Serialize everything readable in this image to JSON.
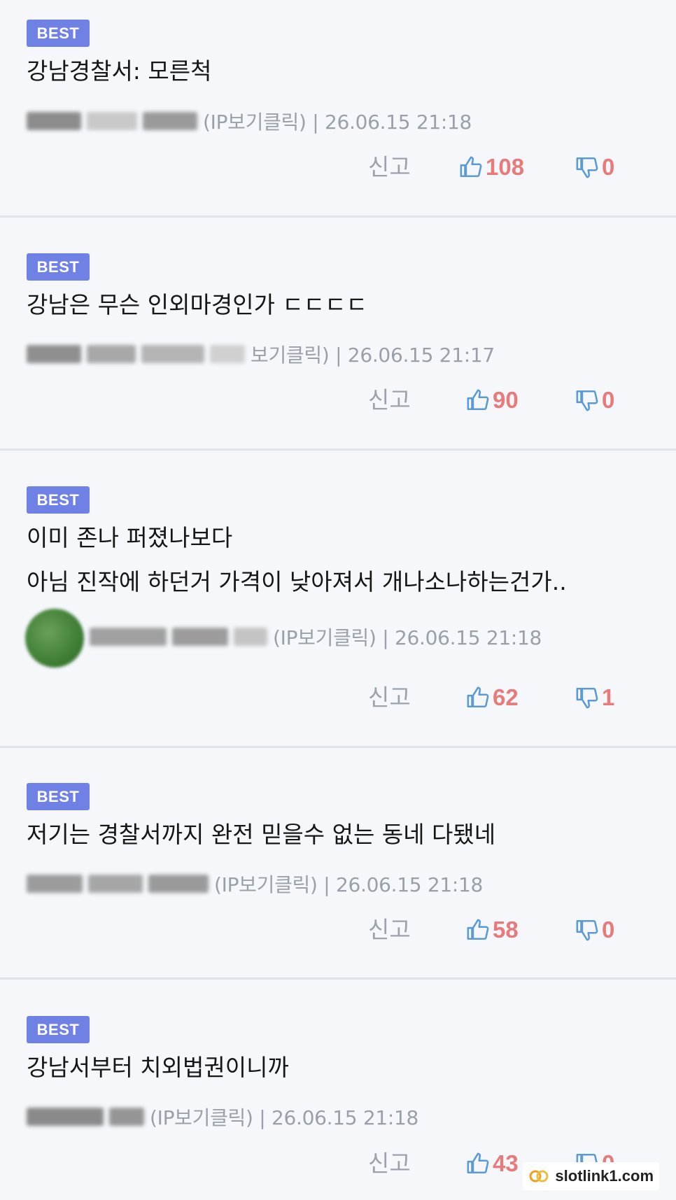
{
  "comments": [
    {
      "badge": "BEST",
      "lines": [
        "강남경찰서: 모른척"
      ],
      "ip_info": "(IP보기클릭) | 26.06.15 21:18",
      "report": "신고",
      "likes": "108",
      "dislikes": "0"
    },
    {
      "badge": "BEST",
      "lines": [
        "강남은 무슨 인외마경인가 ㄷㄷㄷㄷ"
      ],
      "ip_info": "보기클릭) | 26.06.15 21:17",
      "report": "신고",
      "likes": "90",
      "dislikes": "0"
    },
    {
      "badge": "BEST",
      "lines": [
        "이미 존나 퍼졌나보다",
        "아님 진작에 하던거 가격이 낮아져서 개나소나하는건가.."
      ],
      "ip_info": "(IP보기클릭) | 26.06.15 21:18",
      "report": "신고",
      "likes": "62",
      "dislikes": "1"
    },
    {
      "badge": "BEST",
      "lines": [
        "저기는 경찰서까지 완전 믿을수 없는 동네 다됐네"
      ],
      "ip_info": "(IP보기클릭) | 26.06.15 21:18",
      "report": "신고",
      "likes": "58",
      "dislikes": "0"
    },
    {
      "badge": "BEST",
      "lines": [
        "강남서부터 치외법권이니까"
      ],
      "ip_info": "(IP보기클릭) | 26.06.15 21:18",
      "report": "신고",
      "likes": "43",
      "dislikes": "0"
    }
  ],
  "watermark": {
    "text": "slotlink1.com"
  },
  "icons": {
    "like": "thumbs-up-icon",
    "dislike": "thumbs-down-icon",
    "watermark_logo": "slotlink-logo-icon"
  },
  "colors": {
    "badge": "#7081e6",
    "count": "#e77b7b",
    "thumb": "#5b9bd5",
    "meta": "#9aa0a8"
  }
}
